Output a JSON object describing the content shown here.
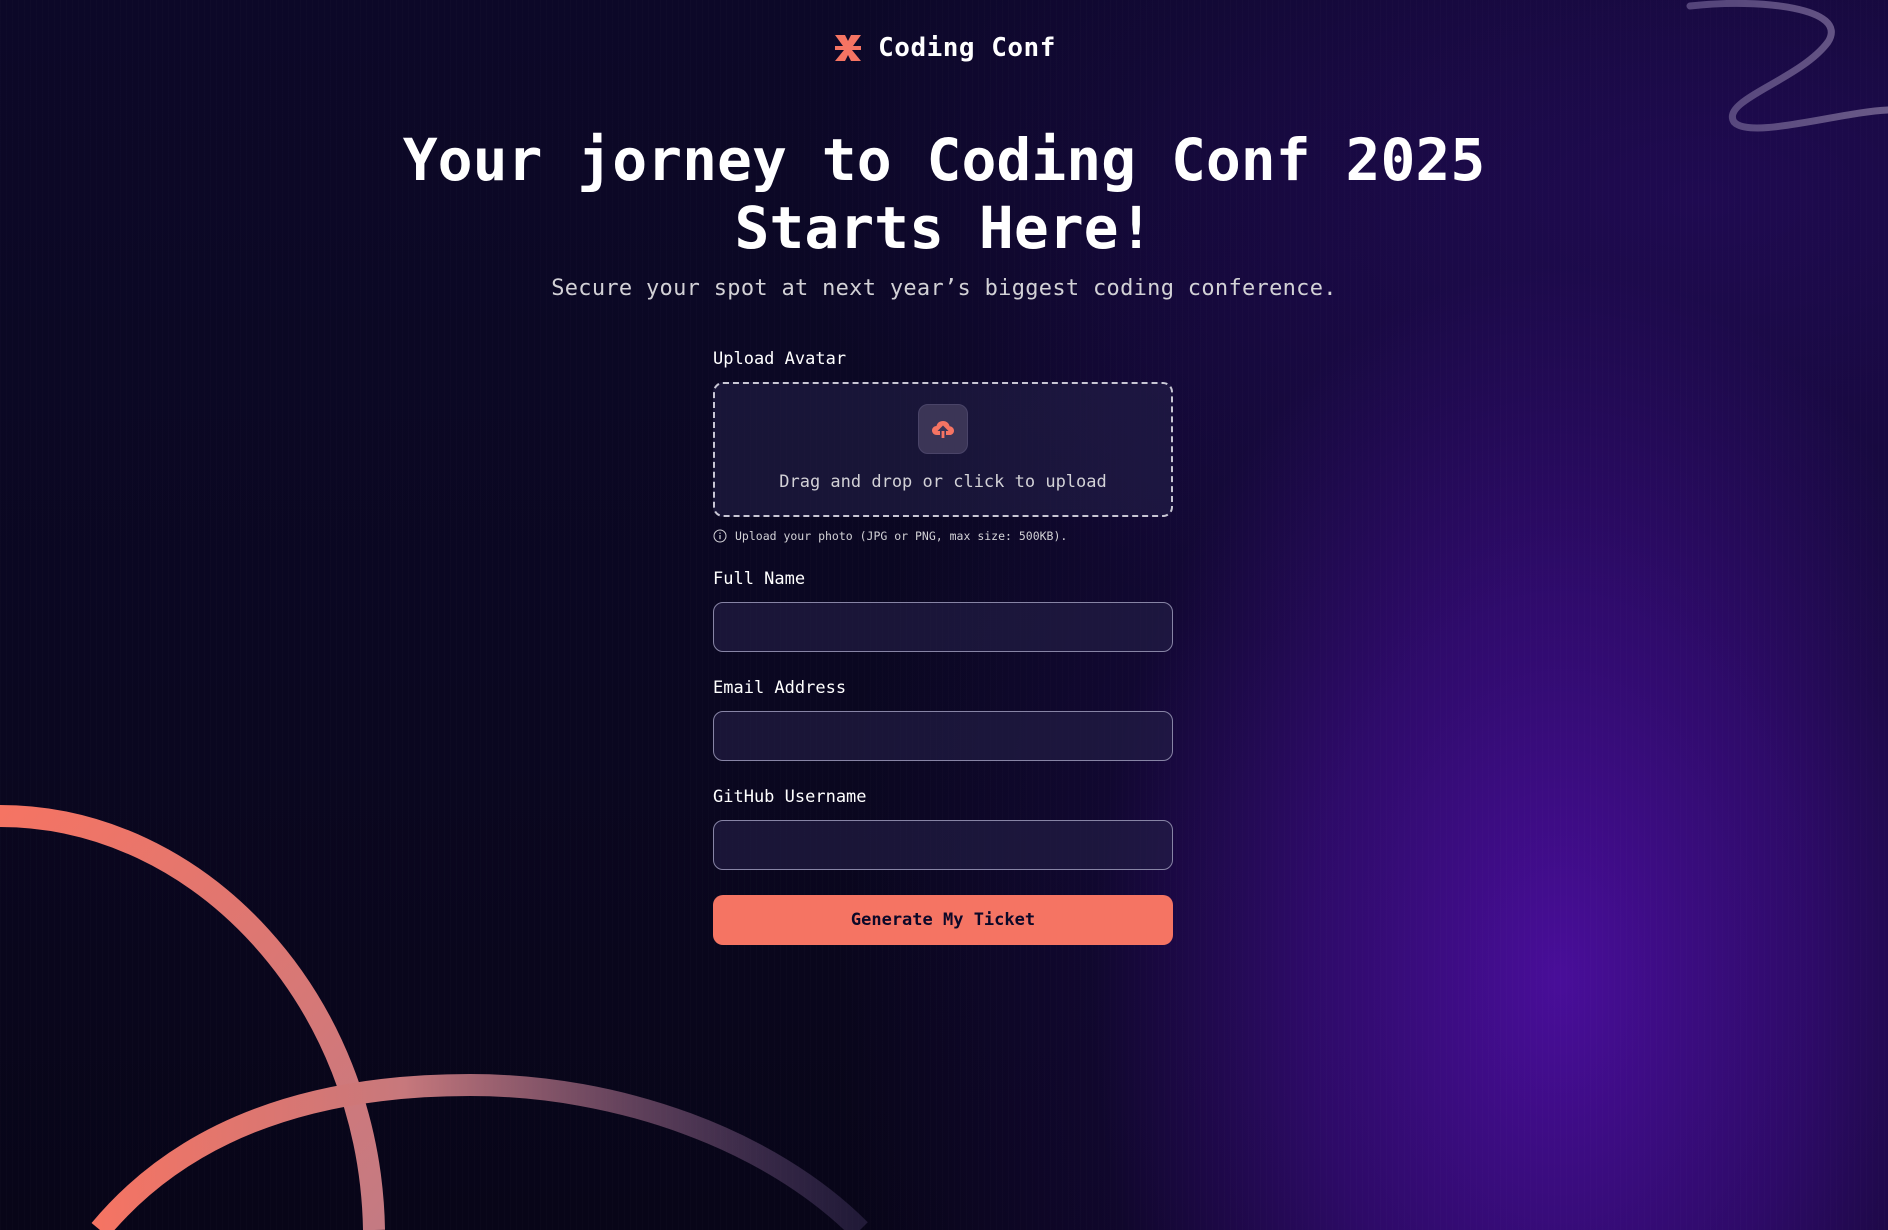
{
  "header": {
    "brand": "Coding Conf"
  },
  "hero": {
    "title": "Your jorney to Coding Conf 2025 Starts Here!",
    "subtitle": "Secure your spot at next year’s biggest coding conference."
  },
  "form": {
    "avatar": {
      "label": "Upload Avatar",
      "dropzone_text": "Drag and drop or click to upload",
      "hint": "Upload your photo (JPG or PNG, max size: 500KB)."
    },
    "full_name": {
      "label": "Full Name",
      "value": ""
    },
    "email": {
      "label": "Email Address",
      "value": ""
    },
    "github": {
      "label": "GitHub Username",
      "value": ""
    },
    "submit_label": "Generate My Ticket"
  },
  "colors": {
    "accent": "#f57463",
    "background": "#0b0825",
    "purple_glow": "#4c0ea0"
  },
  "icons": {
    "logo": "coding-conf-logo-icon",
    "upload": "cloud-upload-icon",
    "hint": "info-icon"
  }
}
